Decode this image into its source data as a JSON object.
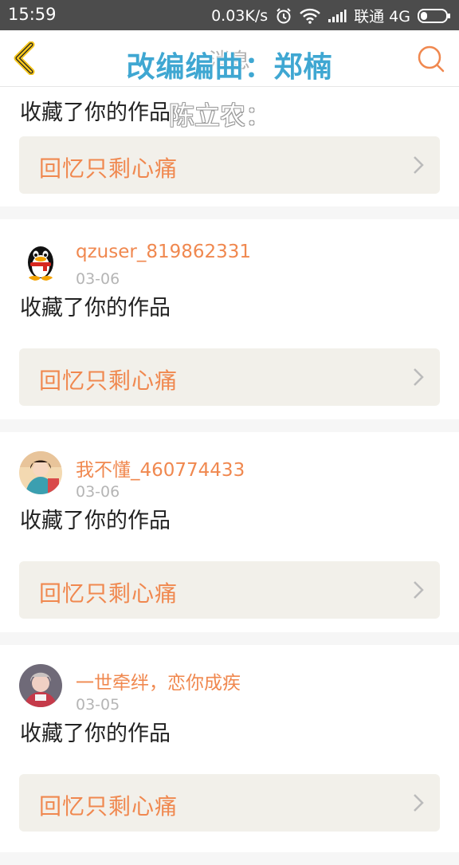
{
  "status": {
    "time": "15:59",
    "speed": "0.03K/s",
    "carrier": "联通 4G"
  },
  "header": {
    "title": "消息"
  },
  "overlay": {
    "line1": "改编编曲：郑楠",
    "line2": "陈立农："
  },
  "feed": [
    {
      "action": "收藏了你的作品",
      "work": "回忆只剩心痛"
    },
    {
      "user": "qzuser_819862331",
      "date": "03-06",
      "action": "收藏了你的作品",
      "work": "回忆只剩心痛",
      "avatar": "penguin-icon"
    },
    {
      "user": "我不懂_460774433",
      "date": "03-06",
      "action": "收藏了你的作品",
      "work": "回忆只剩心痛",
      "avatar": "photo-avatar"
    },
    {
      "user": "一世牵绊，恋你成疾",
      "date": "03-05",
      "action": "收藏了你的作品",
      "work": "回忆只剩心痛",
      "avatar": "photo-avatar"
    }
  ],
  "colors": {
    "accent": "#f0884f",
    "status_bar": "#4c4c4c",
    "work_bg": "#f2f0ea",
    "overlay": "#3fa7d2"
  }
}
